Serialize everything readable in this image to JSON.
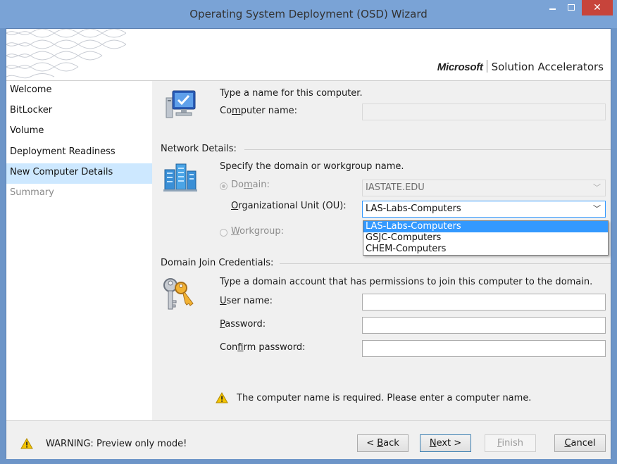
{
  "window": {
    "title": "Operating System Deployment (OSD) Wizard",
    "close_glyph": "✕"
  },
  "banner": {
    "brand_microsoft": "Microsoft",
    "brand_product": "Solution Accelerators"
  },
  "sidebar": {
    "items": [
      {
        "label": "Welcome",
        "state": "normal"
      },
      {
        "label": "BitLocker",
        "state": "normal"
      },
      {
        "label": "Volume",
        "state": "normal"
      },
      {
        "label": "Deployment Readiness",
        "state": "normal"
      },
      {
        "label": "New Computer Details",
        "state": "active"
      },
      {
        "label": "Summary",
        "state": "disabled"
      }
    ]
  },
  "computer": {
    "prompt": "Type a name for this computer.",
    "name_label_pre": "Co",
    "name_label_key": "m",
    "name_label_post": "puter name:",
    "name_value": "",
    "icon": "computer-monitor-icon"
  },
  "network": {
    "section_title": "Network Details:",
    "prompt": "Specify the domain or workgroup name.",
    "domain_label_pre": "Do",
    "domain_label_key": "m",
    "domain_label_post": "ain:",
    "domain_value": "IASTATE.EDU",
    "ou_label_key": "O",
    "ou_label_post": "rganizational Unit (OU):",
    "ou_selected": "LAS-Labs-Computers",
    "ou_options": [
      "LAS-Labs-Computers",
      "GSJC-Computers",
      "CHEM-Computers"
    ],
    "workgroup_label_key": "W",
    "workgroup_label_post": "orkgroup:",
    "icon": "network-servers-icon"
  },
  "credentials": {
    "section_title": "Domain Join Credentials:",
    "prompt": "Type a domain account that has permissions to join this computer to the domain.",
    "username_label_key": "U",
    "username_label_post": "ser name:",
    "password_label_key": "P",
    "password_label_post": "assword:",
    "confirm_label_pre": "Con",
    "confirm_label_key": "f",
    "confirm_label_post": "irm password:",
    "username_value": "",
    "password_value": "",
    "confirm_value": "",
    "icon": "keys-icon"
  },
  "validation_message": "The computer name is required. Please enter a computer name.",
  "footer": {
    "warning": "WARNING: Preview only mode!",
    "back_pre": "< ",
    "back_key": "B",
    "back_post": "ack",
    "next_key": "N",
    "next_post": "ext >",
    "finish_key": "F",
    "finish_post": "inish",
    "cancel_key": "C",
    "cancel_post": "ancel"
  },
  "colors": {
    "accent": "#3399ff",
    "active_nav": "#cde8ff",
    "warning": "#f5c400",
    "titlebar": "#7aa3d6",
    "close": "#c7443b"
  }
}
